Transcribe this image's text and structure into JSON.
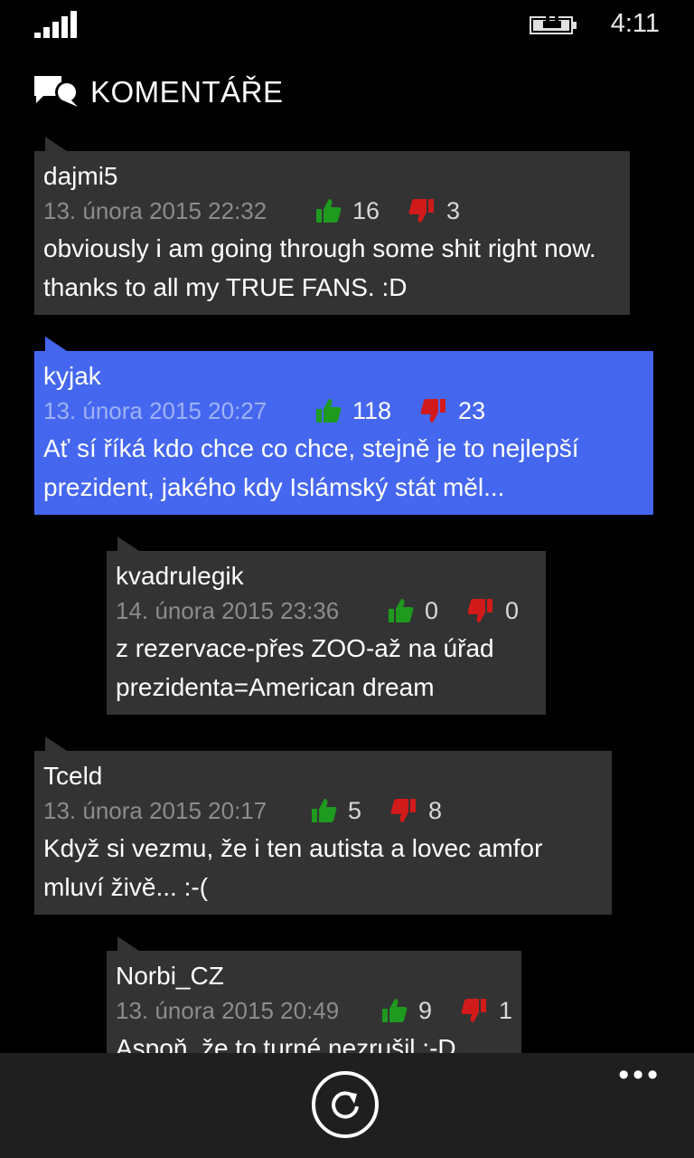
{
  "status": {
    "time": "4:11"
  },
  "header": {
    "title": "KOMENTÁŘE",
    "icon": "comments-icon"
  },
  "comments": [
    {
      "author": "dajmi5",
      "date": "13. února 2015 22:32",
      "likes": "16",
      "dislikes": "3",
      "text": "obviously i am going through some shit right now. thanks to all my TRUE FANS. :D",
      "highlighted": false
    },
    {
      "author": "kyjak",
      "date": "13. února 2015 20:27",
      "likes": "118",
      "dislikes": "23",
      "text": "Ať sí říká kdo chce co chce, stejně je to nejlepší prezident, jakého kdy Islámský stát měl...",
      "highlighted": true
    },
    {
      "author": "kvadrulegik",
      "date": "14. února 2015 23:36",
      "likes": "0",
      "dislikes": "0",
      "text": "z rezervace-přes ZOO-až na úřad prezidenta=American dream",
      "highlighted": false
    },
    {
      "author": "Tceld",
      "date": "13. února 2015 20:17",
      "likes": "5",
      "dislikes": "8",
      "text": "Když si vezmu, že i ten autista a lovec amfor mluví živě... :-(",
      "highlighted": false
    },
    {
      "author": "Norbi_CZ",
      "date": "13. února 2015 20:49",
      "likes": "9",
      "dislikes": "1",
      "text": "Aspoň, že to turné nezrušil :-D",
      "highlighted": false
    }
  ],
  "colors": {
    "background": "#000000",
    "comment_bg": "#333333",
    "highlight_bg": "#4567f0",
    "like": "#1e9a1e",
    "dislike": "#d11a1a",
    "app_bar": "#1f1f1f"
  },
  "app_bar": {
    "refresh_icon": "refresh-icon",
    "more_label": "•••"
  }
}
